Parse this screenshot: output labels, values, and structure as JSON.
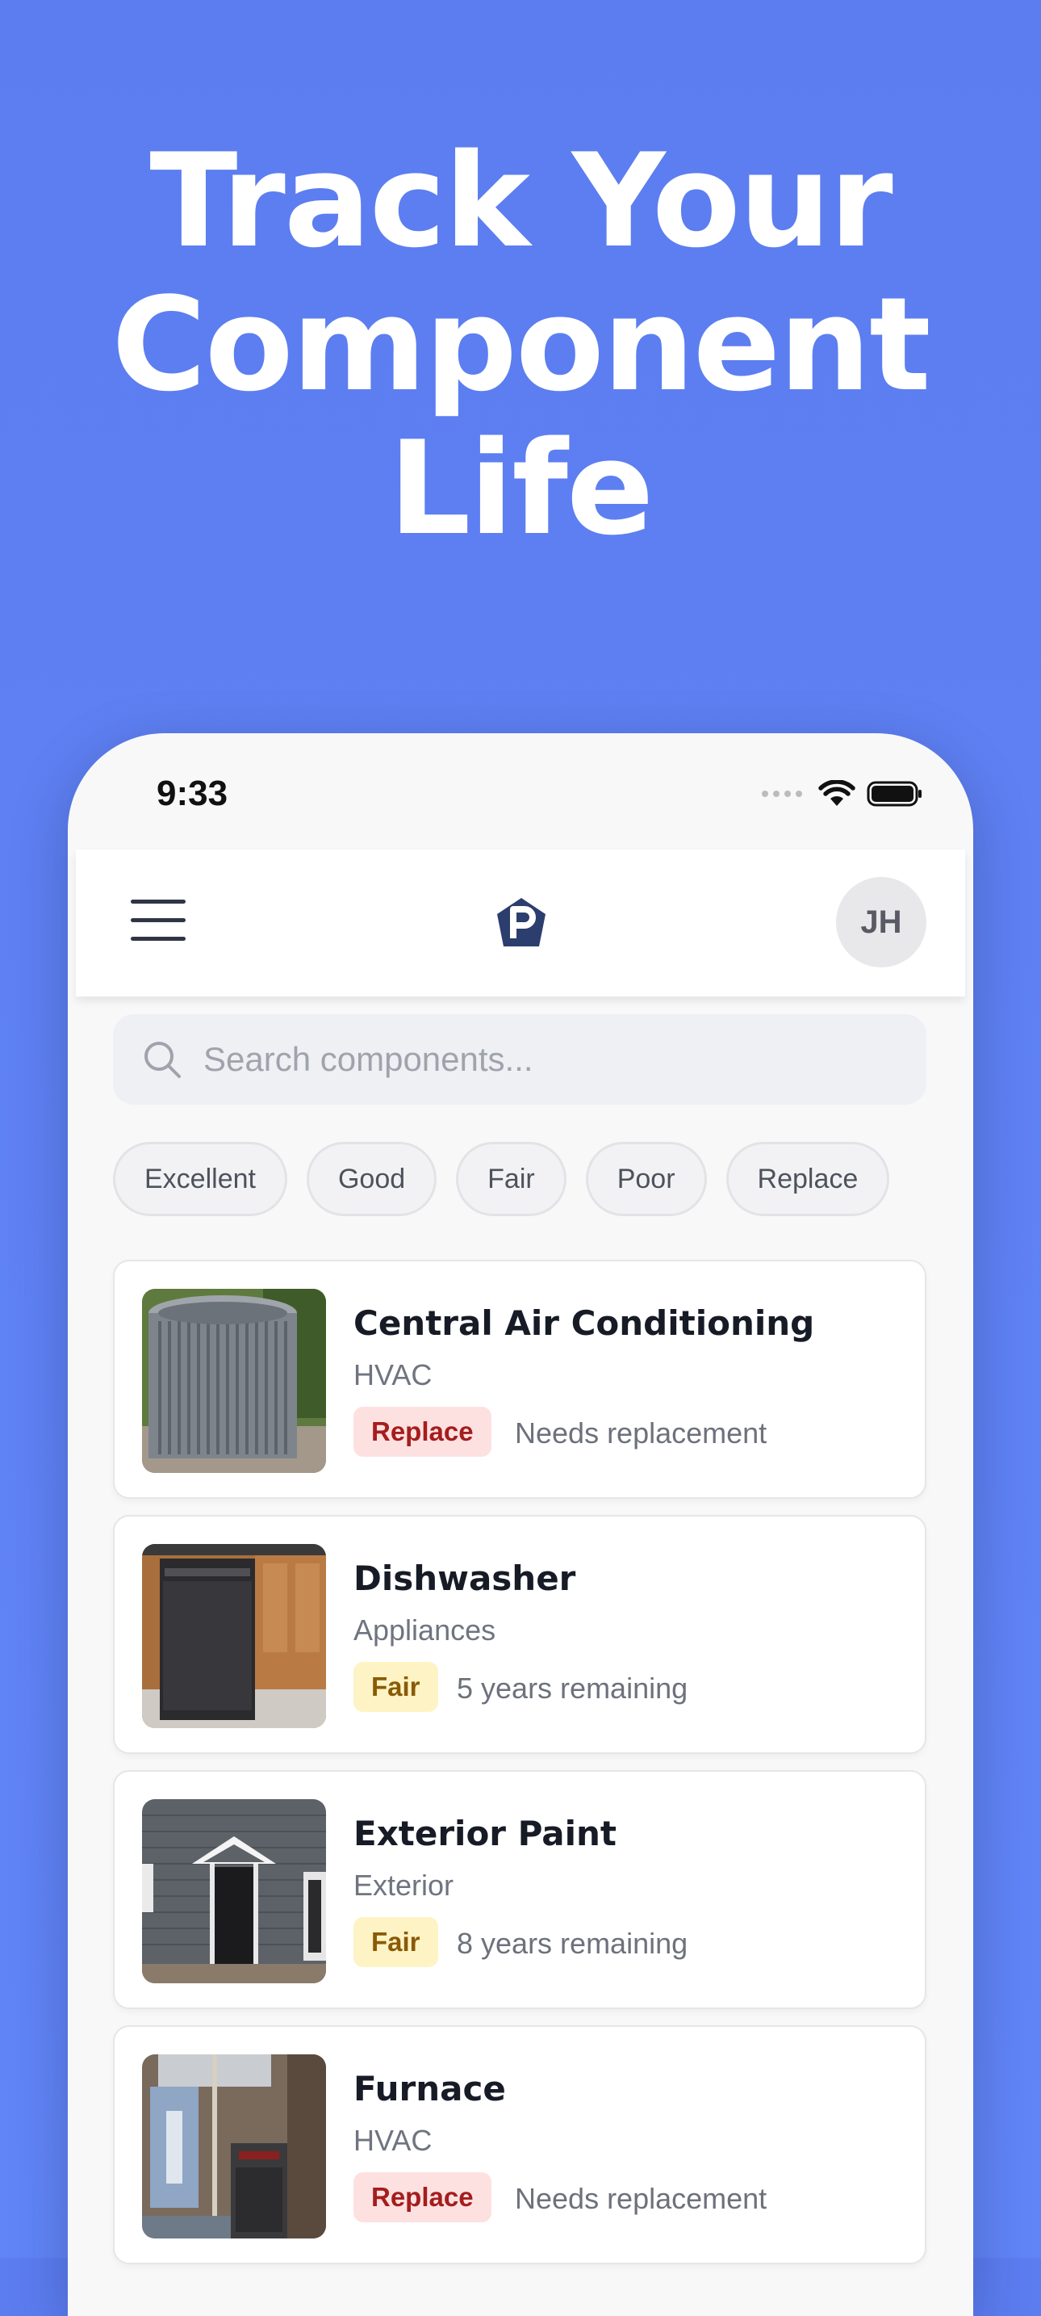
{
  "headline": {
    "line1": "Track Your",
    "line2": "Component",
    "line3": "Life"
  },
  "status_bar": {
    "time": "9:33"
  },
  "header": {
    "avatar_initials": "JH"
  },
  "search": {
    "placeholder": "Search components..."
  },
  "filters": [
    "Excellent",
    "Good",
    "Fair",
    "Poor",
    "Replace"
  ],
  "components": [
    {
      "name": "Central Air Conditioning",
      "category": "HVAC",
      "badge": "Replace",
      "status": "Needs replacement"
    },
    {
      "name": "Dishwasher",
      "category": "Appliances",
      "badge": "Fair",
      "status": "5 years remaining"
    },
    {
      "name": "Exterior Paint",
      "category": "Exterior",
      "badge": "Fair",
      "status": "8 years remaining"
    },
    {
      "name": "Furnace",
      "category": "HVAC",
      "badge": "Replace",
      "status": "Needs replacement"
    }
  ],
  "colors": {
    "background": "#5c7df0",
    "badge_replace_bg": "#fde1e1",
    "badge_replace_text": "#a51d1d",
    "badge_fair_bg": "#fdf3c4",
    "badge_fair_text": "#8a5a06"
  }
}
